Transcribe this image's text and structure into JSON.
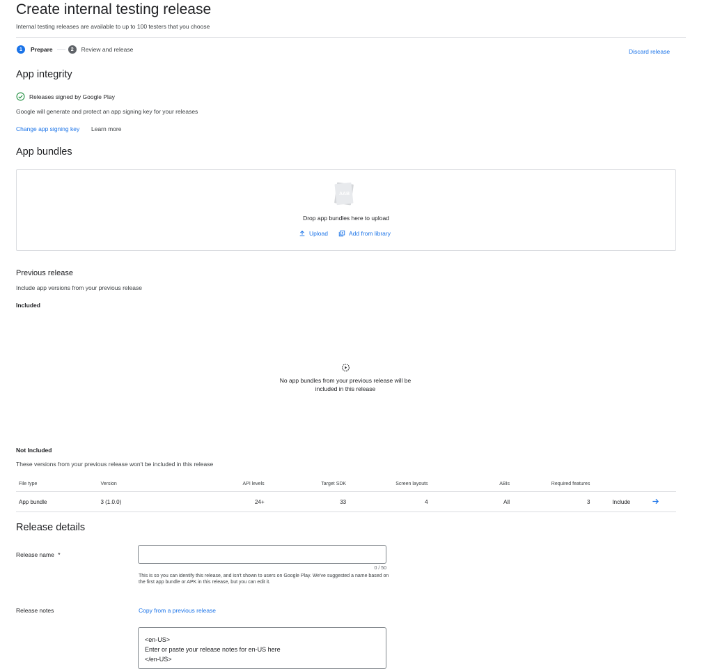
{
  "header": {
    "title": "Create internal testing release",
    "subtitle": "Internal testing releases are available to up to 100 testers that you choose"
  },
  "stepper": {
    "steps": [
      {
        "number": "1",
        "label": "Prepare"
      },
      {
        "number": "2",
        "label": "Review and release"
      }
    ],
    "discard_label": "Discard release"
  },
  "app_integrity": {
    "title": "App integrity",
    "status": "Releases signed by Google Play",
    "description": "Google will generate and protect an app signing key for your releases",
    "change_link": "Change app signing key",
    "learn_more": "Learn more"
  },
  "app_bundles": {
    "title": "App bundles",
    "aab_label": "AAB",
    "drop_text": "Drop app bundles here to upload",
    "upload_label": "Upload",
    "library_label": "Add from library"
  },
  "previous_release": {
    "title": "Previous release",
    "description": "Include app versions from your previous release",
    "included_label": "Included",
    "empty_line1": "No app bundles from your previous release will be",
    "empty_line2": "included in this release",
    "not_included_label": "Not Included",
    "not_included_description": "These versions from your previous release won't be included in this release",
    "table": {
      "headers": [
        "File type",
        "Version",
        "API levels",
        "Target SDK",
        "Screen layouts",
        "ABIs",
        "Required features"
      ],
      "rows": [
        {
          "file_type": "App bundle",
          "version": "3 (1.0.0)",
          "api_levels": "24+",
          "target_sdk": "33",
          "screen_layouts": "4",
          "abis": "All",
          "required_features": "3",
          "action": "Include"
        }
      ]
    }
  },
  "release_details": {
    "title": "Release details",
    "name_label": "Release name",
    "required_mark": "*",
    "name_value": "",
    "name_counter": "0 / 50",
    "name_help": "This is so you can identify this release, and isn't shown to users on Google Play. We've suggested a name based on the first app bundle or APK in this release, but you can edit it.",
    "notes_label": "Release notes",
    "copy_link": "Copy from a previous release",
    "notes_line1": "<en-US>",
    "notes_line2": "Enter or paste your release notes for en-US here",
    "notes_line3": "</en-US>"
  },
  "colors": {
    "accent": "#1a73e8",
    "success": "#1e8e3e",
    "step_active": "#1a73e8",
    "step_inactive": "#5f6368"
  }
}
